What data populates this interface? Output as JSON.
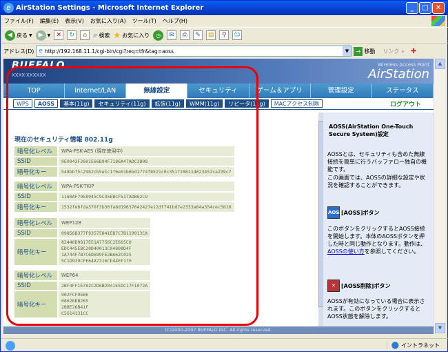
{
  "window": {
    "title": "AirStation Settings - Microsoft Internet Explorer",
    "min": "_",
    "max": "□",
    "close": "✕"
  },
  "menu": [
    "ファイル(F)",
    "編集(E)",
    "表示(V)",
    "お気に入り(A)",
    "ツール(T)",
    "ヘルプ(H)"
  ],
  "toolbar": {
    "back": "戻る",
    "search": "検索",
    "favorites": "お気に入り"
  },
  "address": {
    "label": "アドレス(D)",
    "url": "http://192.168.11.1/cgi-bin/cgi?req=tfr&tag=aoss",
    "go": "移動",
    "links": "リンク »"
  },
  "header": {
    "logo": "BUFFALO",
    "logo_sub": "XXXX-XXXXXX",
    "wap": "Wireless Access Point",
    "product": "AirStation"
  },
  "nav": [
    "TOP",
    "Internet/LAN",
    "無線設定",
    "セキュリティ",
    "ゲーム＆アプリ",
    "管理設定",
    "ステータス"
  ],
  "subnav": {
    "tabs": [
      "WPS",
      "AOSS",
      "基本(11g)",
      "セキュリティ(11g)",
      "拡張(11g)",
      "WMM(11g)",
      "リピータ(11g)",
      "MACアクセス制限"
    ],
    "logout": "ログアウト"
  },
  "security": {
    "title": "現在のセキュリティ情報 802.11g",
    "groups": [
      {
        "level_label": "暗号化レベル",
        "level": "WPA-PSK-AES (現在使用中)",
        "ssid_label": "SSID",
        "ssid": "0E0943F2601E66B94F7186A47ADC3D08",
        "key_label": "暗号化キー",
        "key": "548bbf5c2982cb5e1c1f6e01b6bd1774f8521c0c3517286114623452ca239c7"
      },
      {
        "level_label": "暗号化レベル",
        "level": "WPA-PSK-TKIP",
        "ssid_label": "SSID",
        "ssid": "1160AF7958945C9C35EBCF517ADB62C9",
        "key_label": "暗号化キー",
        "key": "1532fe6fda370f3b30fa8d19637642427e12df741bd7e2333a64a354cec5810"
      },
      {
        "level_label": "暗号化レベル",
        "level": "WEP128",
        "ssid_label": "SSID",
        "ssid": "09856B377F93575D41EB7C7B119913CA",
        "key_label": "暗号化キー",
        "keys": [
          "82446D0817EE1A7756C2E665C0",
          "EDC445EBC20D40013C04888D4F",
          "1A744F7B7C6D699FE2BA62C025",
          "5C1D939CFE64A7316CE44EF170"
        ]
      },
      {
        "level_label": "暗号化レベル",
        "level": "WEP64",
        "ssid_label": "SSID",
        "ssid": "2BF4FF1E782C2D6B2041E5DC17F1072A",
        "key_label": "暗号化キー",
        "keys": [
          "902FCF9E86",
          "08626DB265",
          "2BBE26B41F",
          "C5614131CC"
        ]
      }
    ]
  },
  "footer": "(C)2000-2007 BUFFALO INC. All rights reserved.",
  "help": {
    "title": "AOSS(AirStation One-Touch Secure System)設定",
    "intro": "AOSSとは、セキュリティも含めた無線接続を簡単に行うバッファロー独自の機能です。",
    "intro2": "この画面では、AOSSの詳細な設定や状況を確認することができます。",
    "aoss_btn_title": "[AOSS]ボタン",
    "aoss_btn_icon": "AOSS",
    "aoss_btn_text": "このボタンをクリックするとAOSS接続を開始します。本体のAOSSボタンを押した時と同じ動作となります。動作は、",
    "aoss_link": "AOSSの使い方",
    "aoss_btn_text2": "を参照してください。",
    "aoss_del_title": "[AOSS削除]ボタン",
    "aoss_del_text": "AOSSが有効になっている場合に表示されます。このボタンをクリックするとAOSS状態を解除します。"
  },
  "status": {
    "intranet": "イントラネット"
  }
}
